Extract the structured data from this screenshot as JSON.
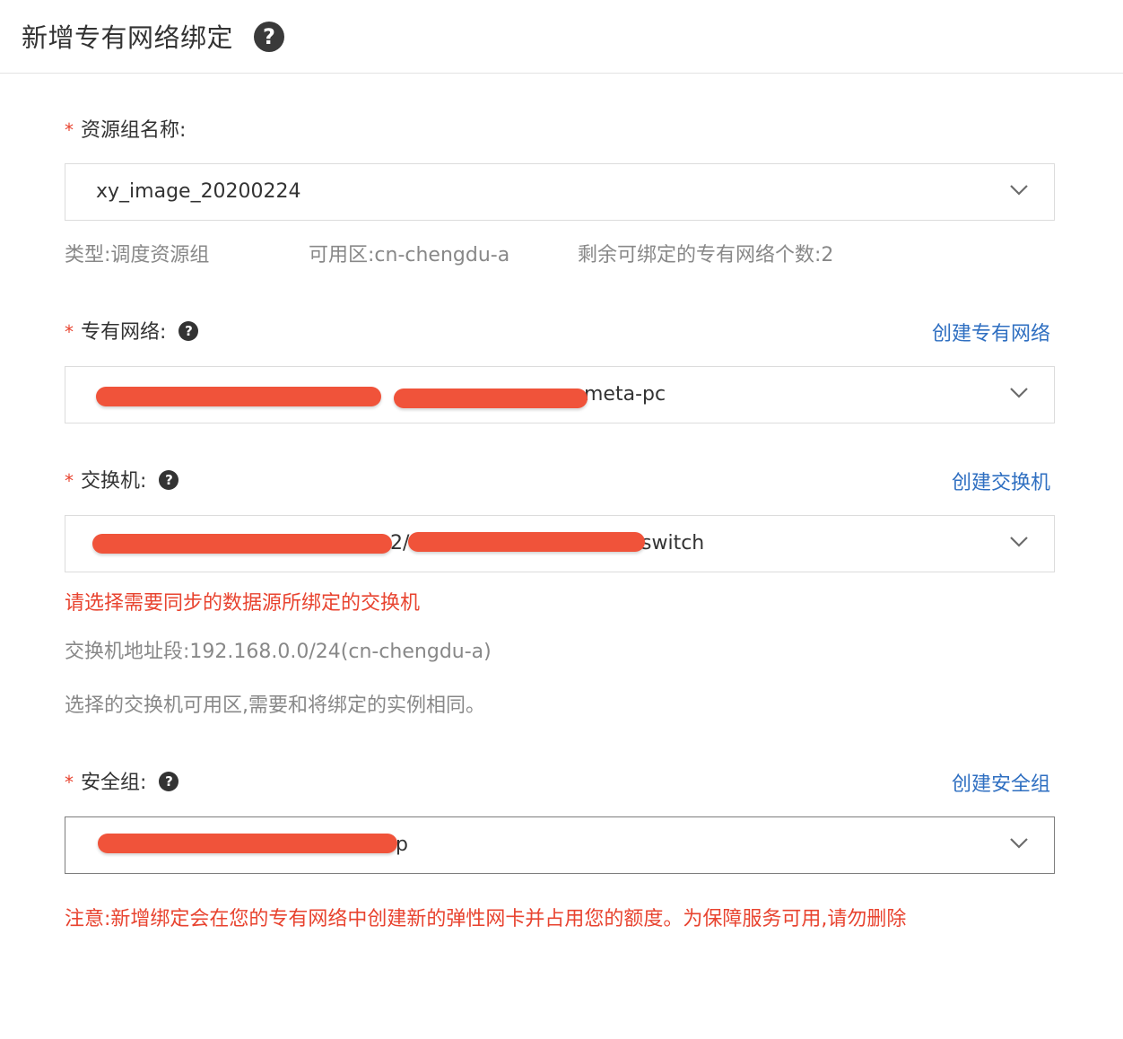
{
  "header": {
    "title": "新增专有网络绑定",
    "help_icon": "question-circle-icon"
  },
  "resource_group": {
    "required_mark": "*",
    "label": "资源组名称:",
    "value": "xy_image_20200224",
    "meta": {
      "type": "类型:调度资源组",
      "zone": "可用区:cn-chengdu-a",
      "remaining": "剩余可绑定的专有网络个数:2"
    }
  },
  "vpc": {
    "required_mark": "*",
    "label": "专有网络:",
    "help": "?",
    "create_link": "创建专有网络",
    "value_visible": "meta-pc"
  },
  "vswitch": {
    "required_mark": "*",
    "label": "交换机:",
    "help": "?",
    "create_link": "创建交换机",
    "value_fragment": "2/",
    "value_visible": "switch",
    "error": "请选择需要同步的数据源所绑定的交换机",
    "cidr": "交换机地址段:192.168.0.0/24(cn-chengdu-a)",
    "hint": "选择的交换机可用区,需要和将绑定的实例相同。"
  },
  "security_group": {
    "required_mark": "*",
    "label": "安全组:",
    "help": "?",
    "create_link": "创建安全组",
    "value_visible": "p"
  },
  "notice": "注意:新增绑定会在您的专有网络中创建新的弹性网卡并占用您的额度。为保障服务可用,请勿删除",
  "colors": {
    "required": "#e8432f",
    "link": "#2f6fc1",
    "redaction": "#f0533a",
    "muted": "#888888"
  }
}
